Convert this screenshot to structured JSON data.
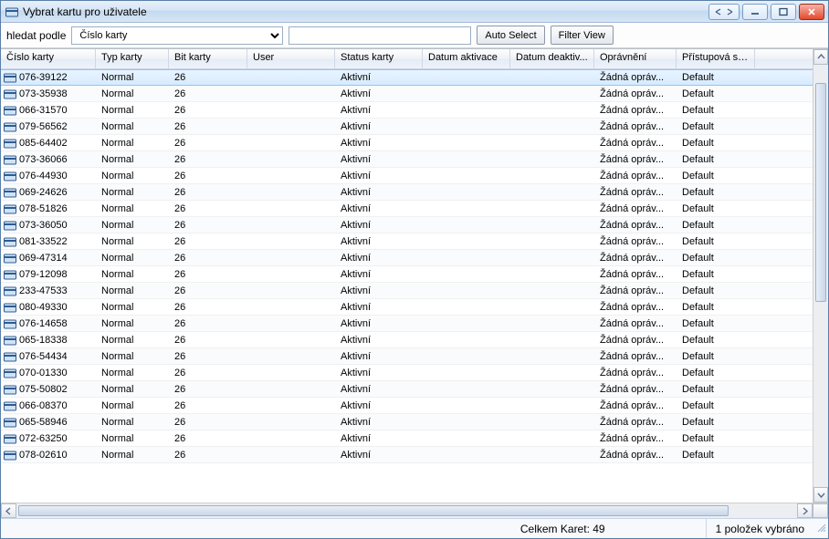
{
  "window": {
    "title": "Vybrat kartu pro uživatele"
  },
  "search": {
    "label": "hledat podle",
    "field_value": "Číslo karty",
    "input_value": "",
    "auto_select": "Auto Select",
    "filter_view": "Filter View"
  },
  "columns": [
    "Číslo karty",
    "Typ karty",
    "Bit karty",
    "User",
    "Status karty",
    "Datum aktivace",
    "Datum deaktiv...",
    "Oprávnění",
    "Přístupová skup..."
  ],
  "rows": [
    {
      "cislo": "076-39122",
      "typ": "Normal",
      "bit": "26",
      "user": "",
      "status": "Aktivní",
      "akt": "",
      "deakt": "",
      "opr": "Žádná opráv...",
      "skup": "Default",
      "selected": true
    },
    {
      "cislo": "073-35938",
      "typ": "Normal",
      "bit": "26",
      "user": "",
      "status": "Aktivní",
      "akt": "",
      "deakt": "",
      "opr": "Žádná opráv...",
      "skup": "Default"
    },
    {
      "cislo": "066-31570",
      "typ": "Normal",
      "bit": "26",
      "user": "",
      "status": "Aktivní",
      "akt": "",
      "deakt": "",
      "opr": "Žádná opráv...",
      "skup": "Default"
    },
    {
      "cislo": "079-56562",
      "typ": "Normal",
      "bit": "26",
      "user": "",
      "status": "Aktivní",
      "akt": "",
      "deakt": "",
      "opr": "Žádná opráv...",
      "skup": "Default"
    },
    {
      "cislo": "085-64402",
      "typ": "Normal",
      "bit": "26",
      "user": "",
      "status": "Aktivní",
      "akt": "",
      "deakt": "",
      "opr": "Žádná opráv...",
      "skup": "Default"
    },
    {
      "cislo": "073-36066",
      "typ": "Normal",
      "bit": "26",
      "user": "",
      "status": "Aktivní",
      "akt": "",
      "deakt": "",
      "opr": "Žádná opráv...",
      "skup": "Default"
    },
    {
      "cislo": "076-44930",
      "typ": "Normal",
      "bit": "26",
      "user": "",
      "status": "Aktivní",
      "akt": "",
      "deakt": "",
      "opr": "Žádná opráv...",
      "skup": "Default"
    },
    {
      "cislo": "069-24626",
      "typ": "Normal",
      "bit": "26",
      "user": "",
      "status": "Aktivní",
      "akt": "",
      "deakt": "",
      "opr": "Žádná opráv...",
      "skup": "Default"
    },
    {
      "cislo": "078-51826",
      "typ": "Normal",
      "bit": "26",
      "user": "",
      "status": "Aktivní",
      "akt": "",
      "deakt": "",
      "opr": "Žádná opráv...",
      "skup": "Default"
    },
    {
      "cislo": "073-36050",
      "typ": "Normal",
      "bit": "26",
      "user": "",
      "status": "Aktivní",
      "akt": "",
      "deakt": "",
      "opr": "Žádná opráv...",
      "skup": "Default"
    },
    {
      "cislo": "081-33522",
      "typ": "Normal",
      "bit": "26",
      "user": "",
      "status": "Aktivní",
      "akt": "",
      "deakt": "",
      "opr": "Žádná opráv...",
      "skup": "Default"
    },
    {
      "cislo": "069-47314",
      "typ": "Normal",
      "bit": "26",
      "user": "",
      "status": "Aktivní",
      "akt": "",
      "deakt": "",
      "opr": "Žádná opráv...",
      "skup": "Default"
    },
    {
      "cislo": "079-12098",
      "typ": "Normal",
      "bit": "26",
      "user": "",
      "status": "Aktivní",
      "akt": "",
      "deakt": "",
      "opr": "Žádná opráv...",
      "skup": "Default"
    },
    {
      "cislo": "233-47533",
      "typ": "Normal",
      "bit": "26",
      "user": "",
      "status": "Aktivní",
      "akt": "",
      "deakt": "",
      "opr": "Žádná opráv...",
      "skup": "Default"
    },
    {
      "cislo": "080-49330",
      "typ": "Normal",
      "bit": "26",
      "user": "",
      "status": "Aktivní",
      "akt": "",
      "deakt": "",
      "opr": "Žádná opráv...",
      "skup": "Default"
    },
    {
      "cislo": "076-14658",
      "typ": "Normal",
      "bit": "26",
      "user": "",
      "status": "Aktivní",
      "akt": "",
      "deakt": "",
      "opr": "Žádná opráv...",
      "skup": "Default"
    },
    {
      "cislo": "065-18338",
      "typ": "Normal",
      "bit": "26",
      "user": "",
      "status": "Aktivní",
      "akt": "",
      "deakt": "",
      "opr": "Žádná opráv...",
      "skup": "Default"
    },
    {
      "cislo": "076-54434",
      "typ": "Normal",
      "bit": "26",
      "user": "",
      "status": "Aktivní",
      "akt": "",
      "deakt": "",
      "opr": "Žádná opráv...",
      "skup": "Default"
    },
    {
      "cislo": "070-01330",
      "typ": "Normal",
      "bit": "26",
      "user": "",
      "status": "Aktivní",
      "akt": "",
      "deakt": "",
      "opr": "Žádná opráv...",
      "skup": "Default"
    },
    {
      "cislo": "075-50802",
      "typ": "Normal",
      "bit": "26",
      "user": "",
      "status": "Aktivní",
      "akt": "",
      "deakt": "",
      "opr": "Žádná opráv...",
      "skup": "Default"
    },
    {
      "cislo": "066-08370",
      "typ": "Normal",
      "bit": "26",
      "user": "",
      "status": "Aktivní",
      "akt": "",
      "deakt": "",
      "opr": "Žádná opráv...",
      "skup": "Default"
    },
    {
      "cislo": "065-58946",
      "typ": "Normal",
      "bit": "26",
      "user": "",
      "status": "Aktivní",
      "akt": "",
      "deakt": "",
      "opr": "Žádná opráv...",
      "skup": "Default"
    },
    {
      "cislo": "072-63250",
      "typ": "Normal",
      "bit": "26",
      "user": "",
      "status": "Aktivní",
      "akt": "",
      "deakt": "",
      "opr": "Žádná opráv...",
      "skup": "Default"
    },
    {
      "cislo": "078-02610",
      "typ": "Normal",
      "bit": "26",
      "user": "",
      "status": "Aktivní",
      "akt": "",
      "deakt": "",
      "opr": "Žádná opráv...",
      "skup": "Default"
    }
  ],
  "status": {
    "total": "Celkem Karet: 49",
    "selected": "1 položek vybráno"
  }
}
